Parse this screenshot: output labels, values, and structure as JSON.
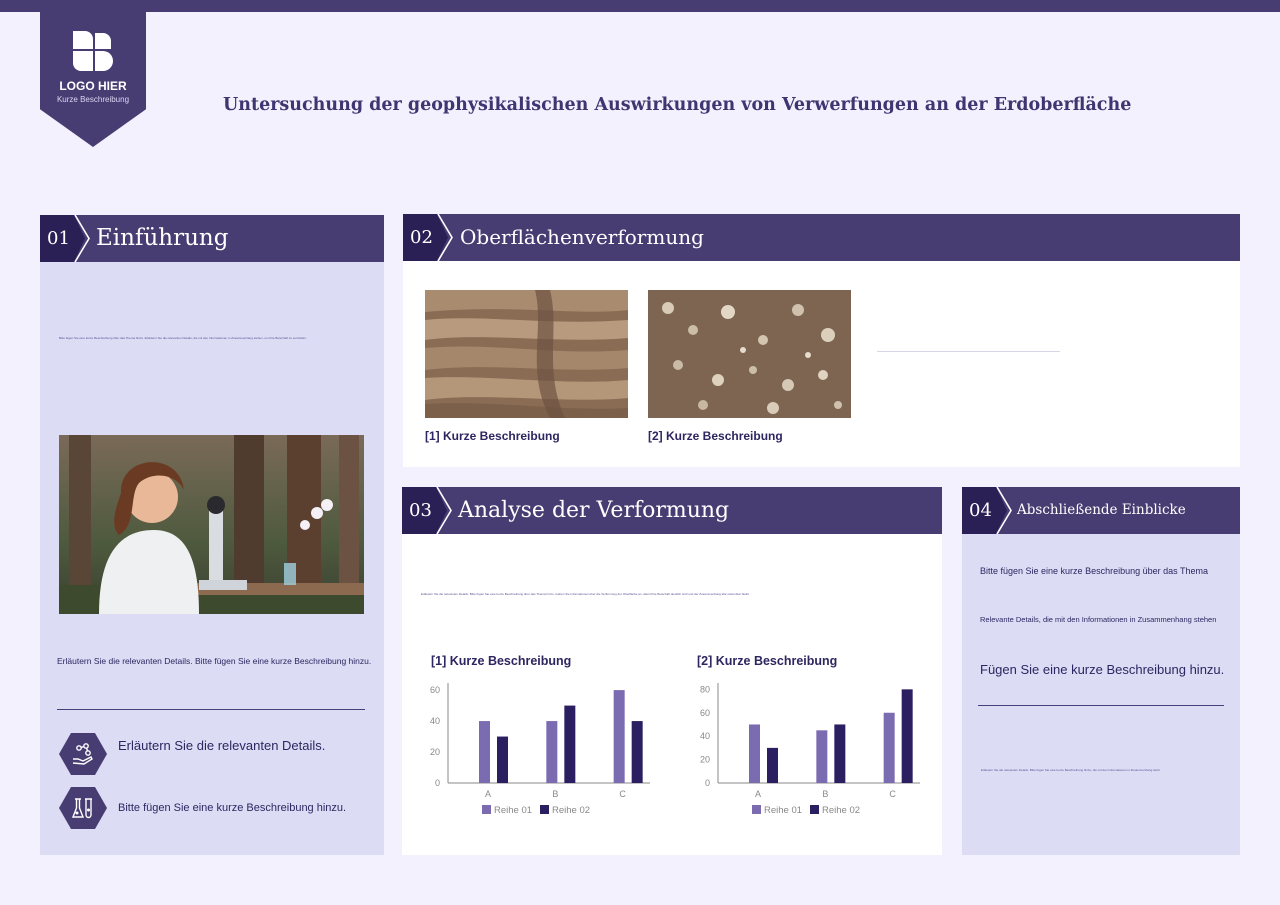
{
  "logo": {
    "title": "LOGO HIER",
    "subtitle": "Kurze Beschreibung",
    "icon": "logo-mark-icon"
  },
  "title": "Untersuchung der geophysikalischen Auswirkungen von Verwerfungen an der Erdoberfläche",
  "colors": {
    "header": "#483d72",
    "header_dark": "#2b2055",
    "panel_light": "#dcdcf5",
    "series1": "#7b6bb1",
    "series2": "#2b1f62"
  },
  "s1": {
    "num": "01",
    "title": "Einführung",
    "tiny": "Bitte fügen Sie eine kurze Beschreibung über das Thema hinzu. Erläutern Sie die relevanten Details, die mit den Informationen in Zusammenhang stehen, um Ihre Botschaft zu vermitteln.",
    "text": "Erläutern Sie die relevanten Details. Bitte fügen Sie eine kurze Beschreibung hinzu.",
    "items": [
      {
        "icon": "hand-molecule-icon",
        "text": "Erläutern Sie die relevanten Details."
      },
      {
        "icon": "lab-flasks-icon",
        "text": "Bitte fügen Sie eine kurze Beschreibung hinzu."
      }
    ]
  },
  "s2": {
    "num": "02",
    "title": "Oberflächenverformung",
    "cap1": "[1] Kurze Beschreibung",
    "cap2": "[2] Kurze Beschreibung"
  },
  "s3": {
    "num": "03",
    "title": "Analyse der Verformung",
    "tiny": "Erläutern Sie die relevanten Details. Bitte fügen Sie eine kurze Beschreibung über das Thema hinzu. Geben Sie Informationen über die Verformung der Oberfläche an, damit Ihre Botschaft deutlich wird und der Zusammenhang klar erkennbar bleibt.",
    "chart1_title": "[1] Kurze Beschreibung",
    "chart2_title": "[2] Kurze Beschreibung"
  },
  "s4": {
    "num": "04",
    "title": "Abschließende Einblicke",
    "t1": "Bitte fügen Sie eine kurze Beschreibung über das Thema",
    "t2": "Relevante Details, die mit den Informationen in Zusammenhang stehen",
    "t3": "Fügen Sie eine kurze Beschreibung hinzu.",
    "tiny": "Erläutern Sie die relevanten Details. Bitte fügen Sie eine kurze Beschreibung hinzu, die mit den Informationen in Zusammenhang steht."
  },
  "chart_data": [
    {
      "type": "bar",
      "title": "[1] Kurze Beschreibung",
      "categories": [
        "A",
        "B",
        "C"
      ],
      "series": [
        {
          "name": "Reihe 01",
          "values": [
            40,
            40,
            60
          ]
        },
        {
          "name": "Reihe 02",
          "values": [
            30,
            50,
            40
          ]
        }
      ],
      "yticks": [
        0,
        20,
        40,
        60
      ],
      "ylim": [
        0,
        62
      ],
      "legend": "bottom"
    },
    {
      "type": "bar",
      "title": "[2] Kurze Beschreibung",
      "categories": [
        "A",
        "B",
        "C"
      ],
      "series": [
        {
          "name": "Reihe 01",
          "values": [
            50,
            45,
            60
          ]
        },
        {
          "name": "Reihe 02",
          "values": [
            30,
            50,
            80
          ]
        }
      ],
      "yticks": [
        0,
        20,
        40,
        60,
        80
      ],
      "ylim": [
        0,
        82
      ],
      "legend": "bottom"
    }
  ]
}
